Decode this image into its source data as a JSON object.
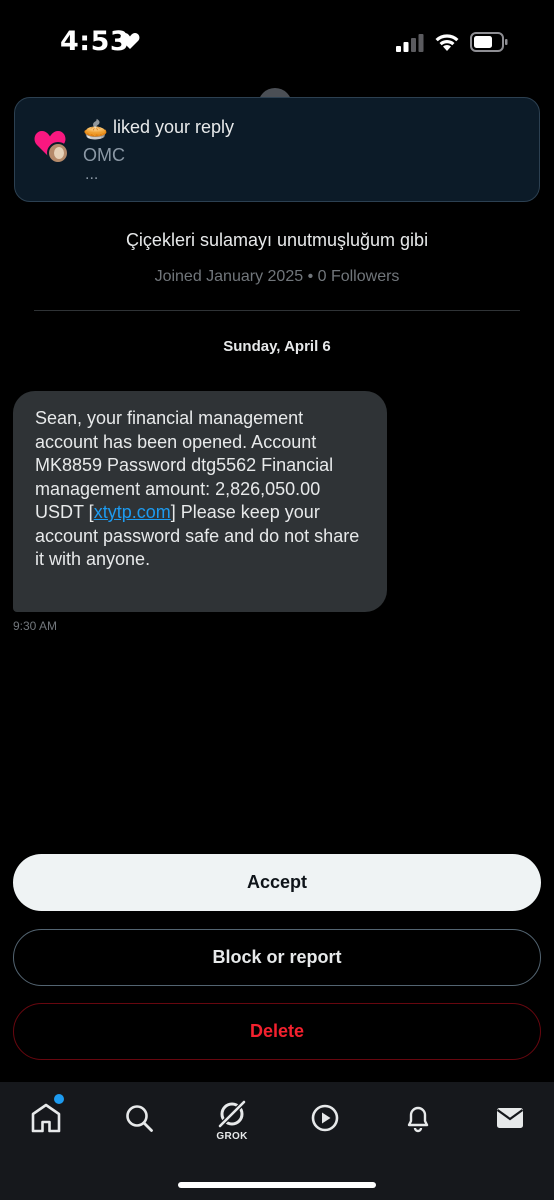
{
  "status_bar": {
    "time": "4:53"
  },
  "toast": {
    "emoji": "🥧",
    "text": "liked your reply",
    "name": "OMC",
    "ellipsis": "..."
  },
  "profile": {
    "bio": "Çiçekleri sulamayı unutmuşluğum gibi",
    "joined": "Joined January 2025 • 0 Followers"
  },
  "conversation": {
    "date": "Sunday, April 6",
    "message": {
      "text_before_link": "Sean, your financial management account has been opened. Account MK8859 Password dtg5562 Financial management amount: 2,826,050.00 USDT [",
      "link": "xtytp.com",
      "text_after_link": "] Please keep your account password safe and do not share it with anyone.",
      "time": "9:30 AM"
    }
  },
  "actions": {
    "accept": "Accept",
    "block": "Block or report",
    "delete": "Delete"
  },
  "tab_bar": {
    "grok_label": "GROK"
  },
  "colors": {
    "accent": "#1d9bf0",
    "delete": "#f4212e",
    "bubble": "#2f3336",
    "toast_bg": "#0c1b28",
    "heart": "#f91880"
  }
}
